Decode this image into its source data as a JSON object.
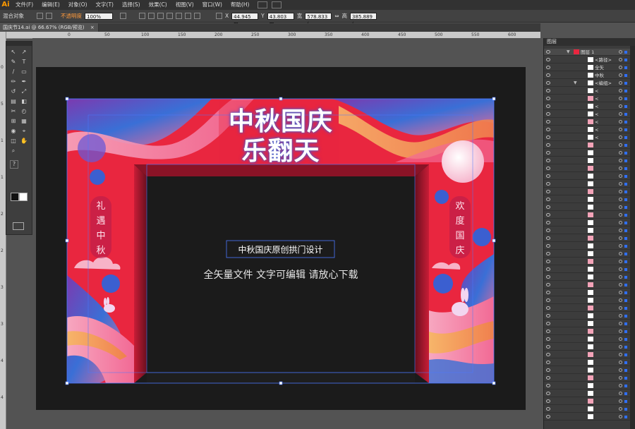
{
  "app": {
    "logo": "Ai"
  },
  "menu": [
    "文件(F)",
    "编辑(E)",
    "对象(O)",
    "文字(T)",
    "选择(S)",
    "效果(C)",
    "视图(V)",
    "窗口(W)",
    "帮助(H)"
  ],
  "control": {
    "selection": "混合对象",
    "opacity_label": "不透明度",
    "opacity_value": "100%",
    "x_value": "44.945 m",
    "y_value": "43.803 m",
    "w_value": "578.833 (",
    "h_value": "385.889 ("
  },
  "document_tab": {
    "title": "国庆节14.ai @ 66.67% (RGB/预览)",
    "close": "×"
  },
  "ruler_h": [
    "0",
    "50",
    "100",
    "150",
    "200",
    "250",
    "300",
    "350",
    "400",
    "450",
    "500",
    "550",
    "600",
    "650",
    "700"
  ],
  "ruler_v": [
    "0",
    "5",
    "1",
    "1",
    "2",
    "2",
    "3",
    "3",
    "4",
    "4"
  ],
  "tools": {
    "help": "?"
  },
  "artwork": {
    "title_line1": "中秋国庆",
    "title_line2": "乐翻天",
    "left_badge": [
      "礼",
      "遇",
      "中",
      "秋"
    ],
    "right_badge": [
      "欢",
      "度",
      "国",
      "庆"
    ],
    "subtitle": "中秋国庆原创拱门设计",
    "tagline": "全矢量文件 文字可编辑 请放心下载",
    "colors": {
      "red": "#e9263f",
      "pink": "#f26a95",
      "purple": "#7b3ab0",
      "blue": "#3a6fd6",
      "dark": "#1b1b1b"
    }
  },
  "layers_panel": {
    "title": "图层",
    "rows": [
      {
        "name": "图层 1",
        "expanded": true
      },
      {
        "name": "<路径>"
      },
      {
        "name": "全矢"
      },
      {
        "name": "中秋"
      },
      {
        "name": "<编组>",
        "expanded": true
      },
      {
        "name": "<"
      },
      {
        "name": "<"
      },
      {
        "name": "<"
      },
      {
        "name": "<"
      },
      {
        "name": "<"
      },
      {
        "name": "<"
      },
      {
        "name": "<"
      }
    ],
    "extra_rows": 36
  }
}
